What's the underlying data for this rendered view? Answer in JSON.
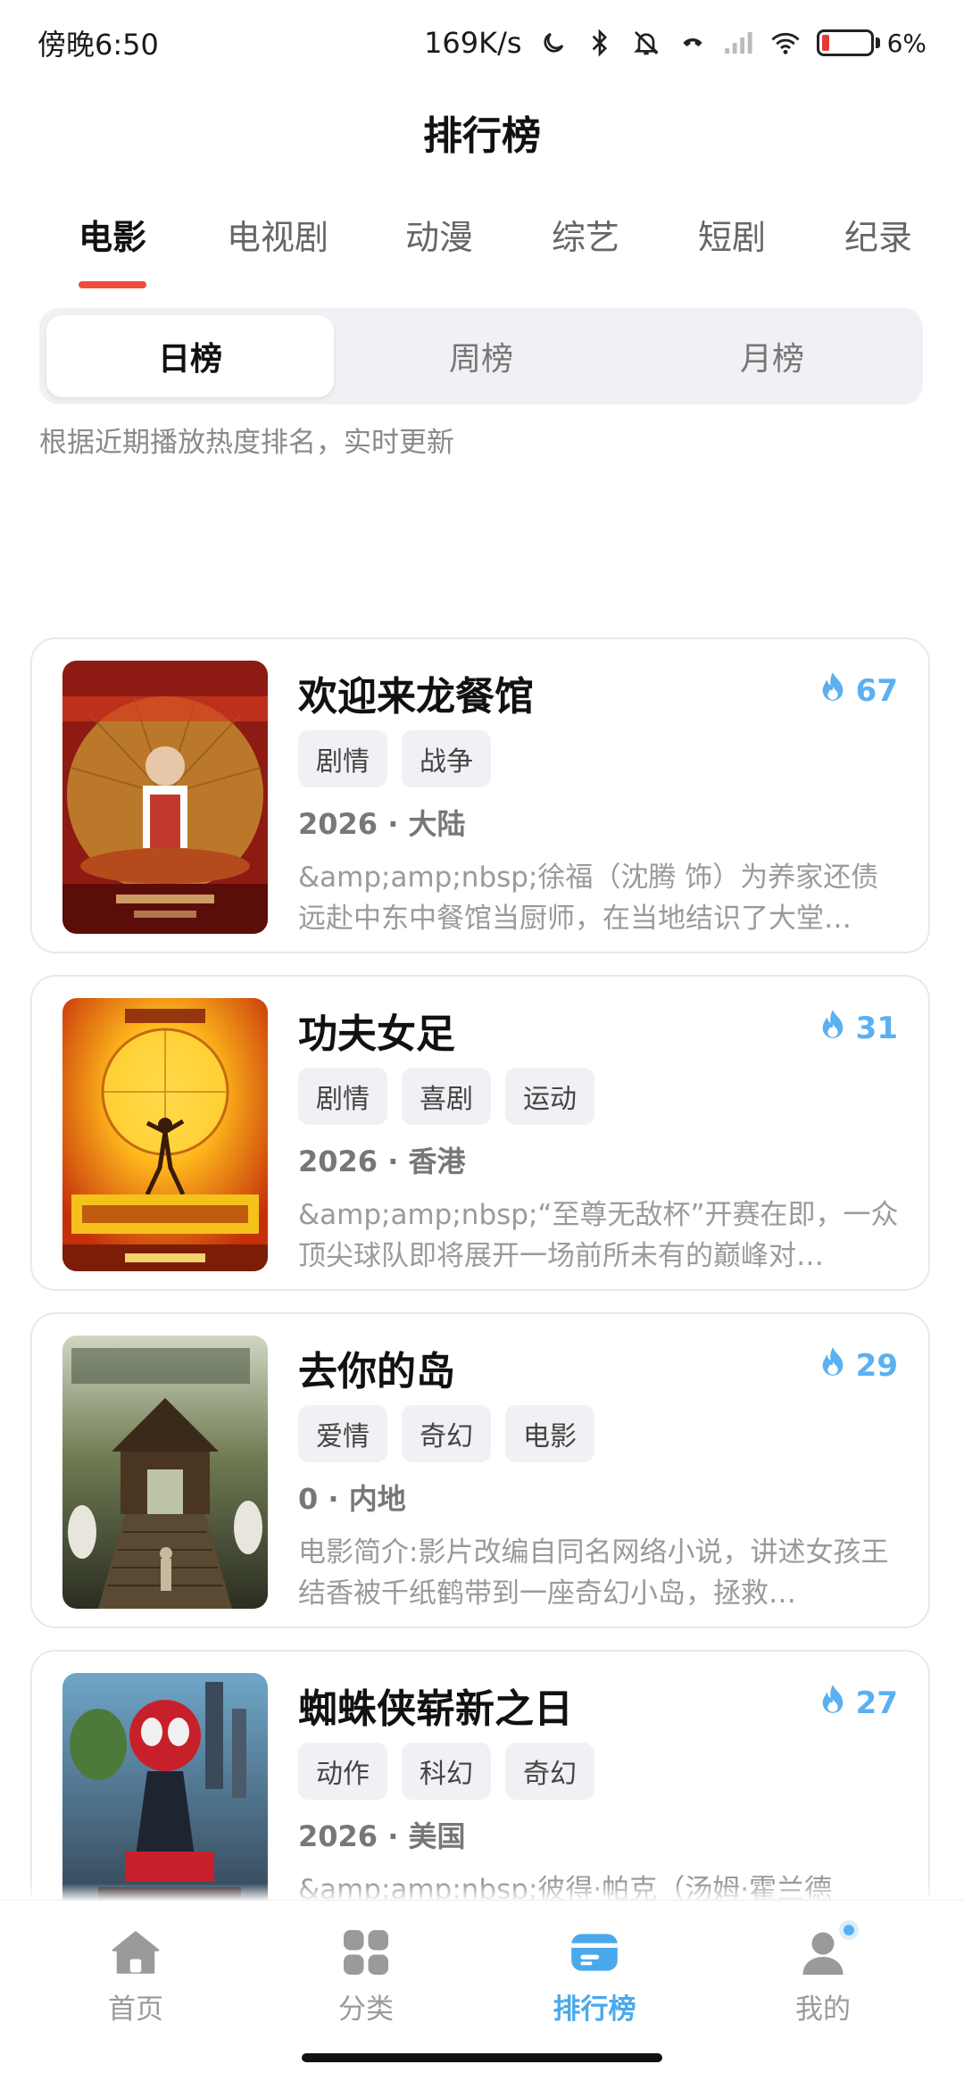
{
  "status": {
    "time": "傍晚6:50",
    "net_speed": "169K/s",
    "battery": "6%",
    "icons": [
      "moon-icon",
      "bluetooth-icon",
      "bell-off-icon",
      "call-icon",
      "signal-icon",
      "wifi-icon",
      "battery-icon"
    ]
  },
  "header": {
    "title": "排行榜"
  },
  "category_tabs": [
    {
      "label": "电影",
      "active": true
    },
    {
      "label": "电视剧"
    },
    {
      "label": "动漫"
    },
    {
      "label": "综艺"
    },
    {
      "label": "短剧"
    },
    {
      "label": "纪录"
    }
  ],
  "period_tabs": [
    {
      "label": "日榜",
      "active": true
    },
    {
      "label": "周榜"
    },
    {
      "label": "月榜"
    }
  ],
  "hint": "根据近期播放热度排名，实时更新",
  "colors": {
    "accent_red": "#f04a3e",
    "accent_blue": "#4aa9ec",
    "heat_blue": "#5ab0f0"
  },
  "items": [
    {
      "title": "欢迎来龙餐馆",
      "heat": "67",
      "tags": [
        "剧情",
        "战争"
      ],
      "meta": "2026 · 大陆",
      "desc": "&amp;amp;nbsp;徐福（沈腾 饰）为养家还债远赴中东中餐馆当厨师，在当地结识了大堂…"
    },
    {
      "title": "功夫女足",
      "heat": "31",
      "tags": [
        "剧情",
        "喜剧",
        "运动"
      ],
      "meta": "2026 · 香港",
      "desc": "&amp;amp;nbsp;“至尊无敌杯”开赛在即，一众顶尖球队即将展开一场前所未有的巅峰对…"
    },
    {
      "title": "去你的岛",
      "heat": "29",
      "tags": [
        "爱情",
        "奇幻",
        "电影"
      ],
      "meta": "0 · 内地",
      "desc": "电影简介:影片改编自同名网络小说，讲述女孩王结香被千纸鹤带到一座奇幻小岛，拯救…"
    },
    {
      "title": "蜘蛛侠崭新之日",
      "heat": "27",
      "tags": [
        "动作",
        "科幻",
        "奇幻"
      ],
      "meta": "2026 · 美国",
      "desc": "&amp;amp;nbsp;彼得·帕克（汤姆·霍兰德"
    }
  ],
  "nav": [
    {
      "label": "首页",
      "icon": "home-icon"
    },
    {
      "label": "分类",
      "icon": "grid-icon"
    },
    {
      "label": "排行榜",
      "icon": "ranking-icon",
      "active": true
    },
    {
      "label": "我的",
      "icon": "user-icon"
    }
  ]
}
